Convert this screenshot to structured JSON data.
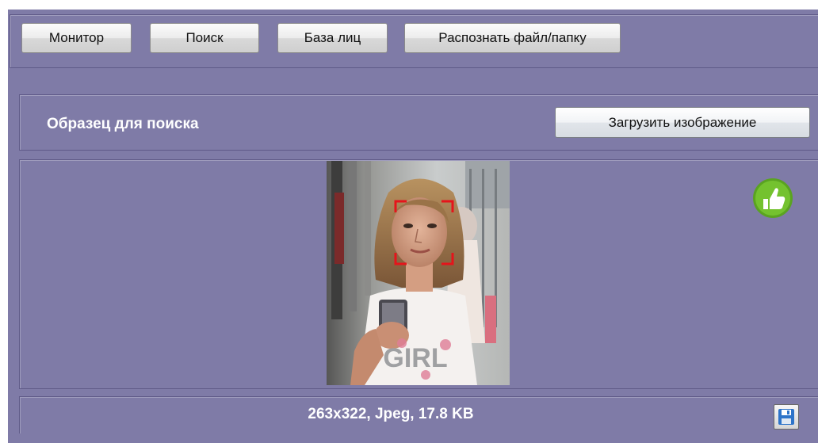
{
  "toolbar": {
    "monitor_label": "Монитор",
    "search_label": "Поиск",
    "face_db_label": "База лиц",
    "recognize_label": "Распознать файл/папку"
  },
  "search_sample": {
    "title": "Образец для поиска",
    "load_button_label": "Загрузить изображение"
  },
  "preview": {
    "shirt_text": "GIRL",
    "status_icon": "thumbs-up-icon",
    "status_color": "#6fbf2a",
    "face_frame_color": "#e5141b"
  },
  "footer": {
    "file_info": "263x322, Jpeg, 17.8 KB",
    "save_icon": "save-icon"
  },
  "colors": {
    "background": "#7f7ba7",
    "label_text": "#ffffff"
  }
}
